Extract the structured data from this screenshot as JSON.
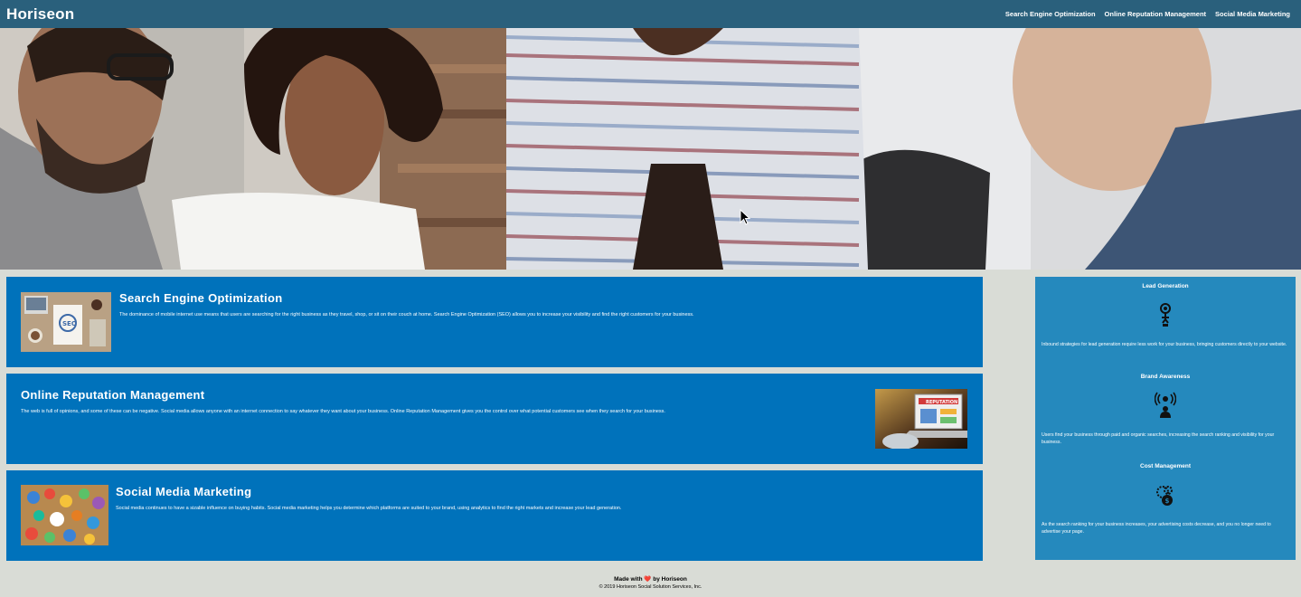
{
  "header": {
    "logo": "Horiseon",
    "nav": [
      "Search Engine Optimization",
      "Online Reputation Management",
      "Social Media Marketing"
    ]
  },
  "hero": {
    "icon": "team-meeting-photo"
  },
  "content": [
    {
      "title": "Search Engine Optimization",
      "text": "The dominance of mobile internet use means that users are searching for the right business as they travel, shop, or sit on their couch at home. Search Engine Optimization (SEO) allows you to increase your visibility and find the right customers for your business."
    },
    {
      "title": "Online Reputation Management",
      "text": "The web is full of opinions, and some of these can be negative. Social media allows anyone with an internet connection to say whatever they want about your business. Online Reputation Management gives you the control over what potential customers see when they search for your business."
    },
    {
      "title": "Social Media Marketing",
      "text": "Social media continues to have a sizable influence on buying habits. Social media marketing helps you determine which platforms are suited to your brand, using analytics to find the right markets and increase your lead generation."
    }
  ],
  "benefits": [
    {
      "title": "Lead Generation",
      "icon": "lead-generation-icon",
      "text": "Inbound strategies for lead generation require less work for your business, bringing customers directly to your website."
    },
    {
      "title": "Brand Awareness",
      "icon": "brand-awareness-icon",
      "text": "Users find your business through paid and organic searches, increasing the search ranking and visibility for your business."
    },
    {
      "title": "Cost Management",
      "icon": "cost-management-icon",
      "text": "As the search ranking for your business increases, your advertising costs decrease, and you no longer need to advertise your page."
    }
  ],
  "footer": {
    "made_prefix": "Made with",
    "heart": "❤️",
    "made_suffix": "by Horiseon",
    "copyright": "© 2019 Horiseon Social Solution Services, Inc."
  },
  "colors": {
    "header_bg": "#2a607c",
    "card_bg": "#0072bb",
    "sidebar_bg": "#2589bd",
    "page_bg": "#d9dcd6"
  }
}
